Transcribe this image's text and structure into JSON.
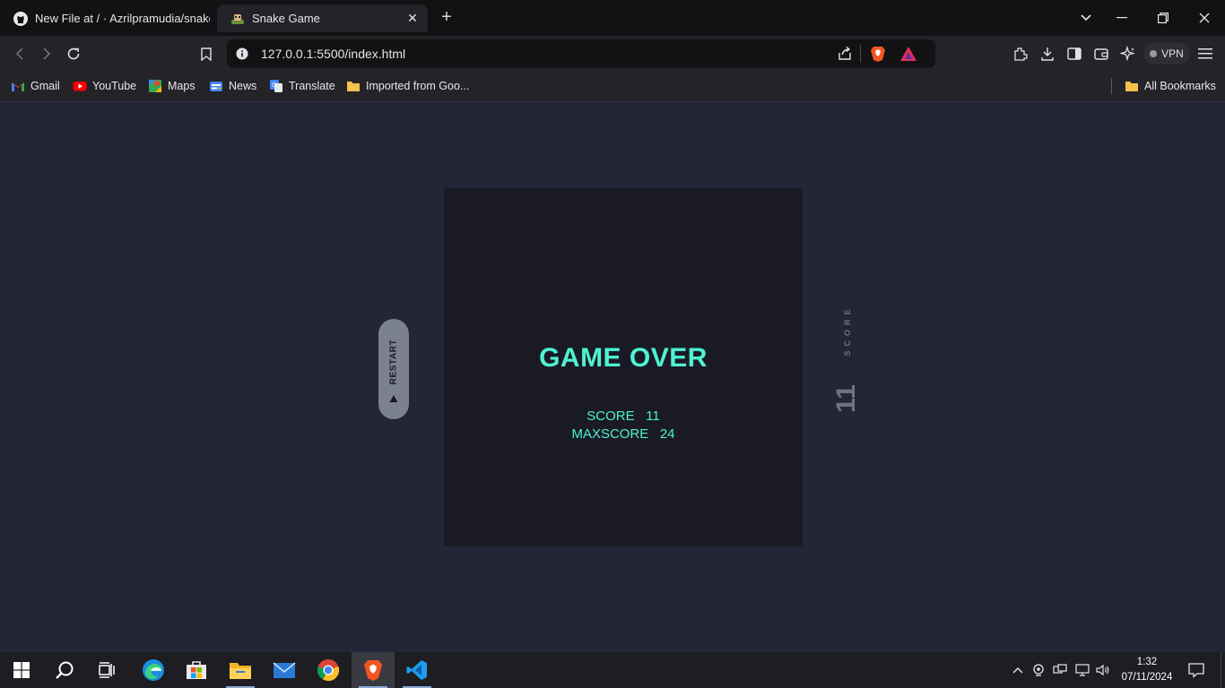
{
  "browser": {
    "tabs": [
      {
        "title": "New File at / · Azrilpramudia/snake-",
        "icon": "github-icon"
      },
      {
        "title": "Snake Game",
        "icon": "snake-game-icon",
        "active": true
      }
    ],
    "url": "127.0.0.1:5500/index.html",
    "vpn_label": "VPN",
    "bookmarks": [
      {
        "label": "Gmail",
        "icon": "gmail-icon"
      },
      {
        "label": "YouTube",
        "icon": "youtube-icon"
      },
      {
        "label": "Maps",
        "icon": "maps-icon"
      },
      {
        "label": "News",
        "icon": "news-icon"
      },
      {
        "label": "Translate",
        "icon": "translate-icon"
      },
      {
        "label": "Imported from Goo...",
        "icon": "folder-icon"
      }
    ],
    "all_bookmarks": "All Bookmarks"
  },
  "game": {
    "title": "GAME OVER",
    "score_label": "SCORE",
    "score": "11",
    "maxscore_label": "MAXSCORE",
    "maxscore": "24",
    "restart_label": "RESTART",
    "side_score_label": "SCORE",
    "side_score_value": "11"
  },
  "taskbar": {
    "apps": [
      "start-icon",
      "search-icon",
      "task-view-icon",
      "edge-icon",
      "store-icon",
      "file-explorer-icon",
      "mail-icon",
      "chrome-icon",
      "brave-icon",
      "vscode-icon"
    ],
    "active_app": "brave-icon",
    "time": "1:32",
    "date": "07/11/2024"
  },
  "colors": {
    "page_background": "#222637",
    "board_background": "#1a1a24",
    "accent_text": "#4ff2d2",
    "muted": "#6f7383",
    "restart_button": "#7c8191"
  }
}
